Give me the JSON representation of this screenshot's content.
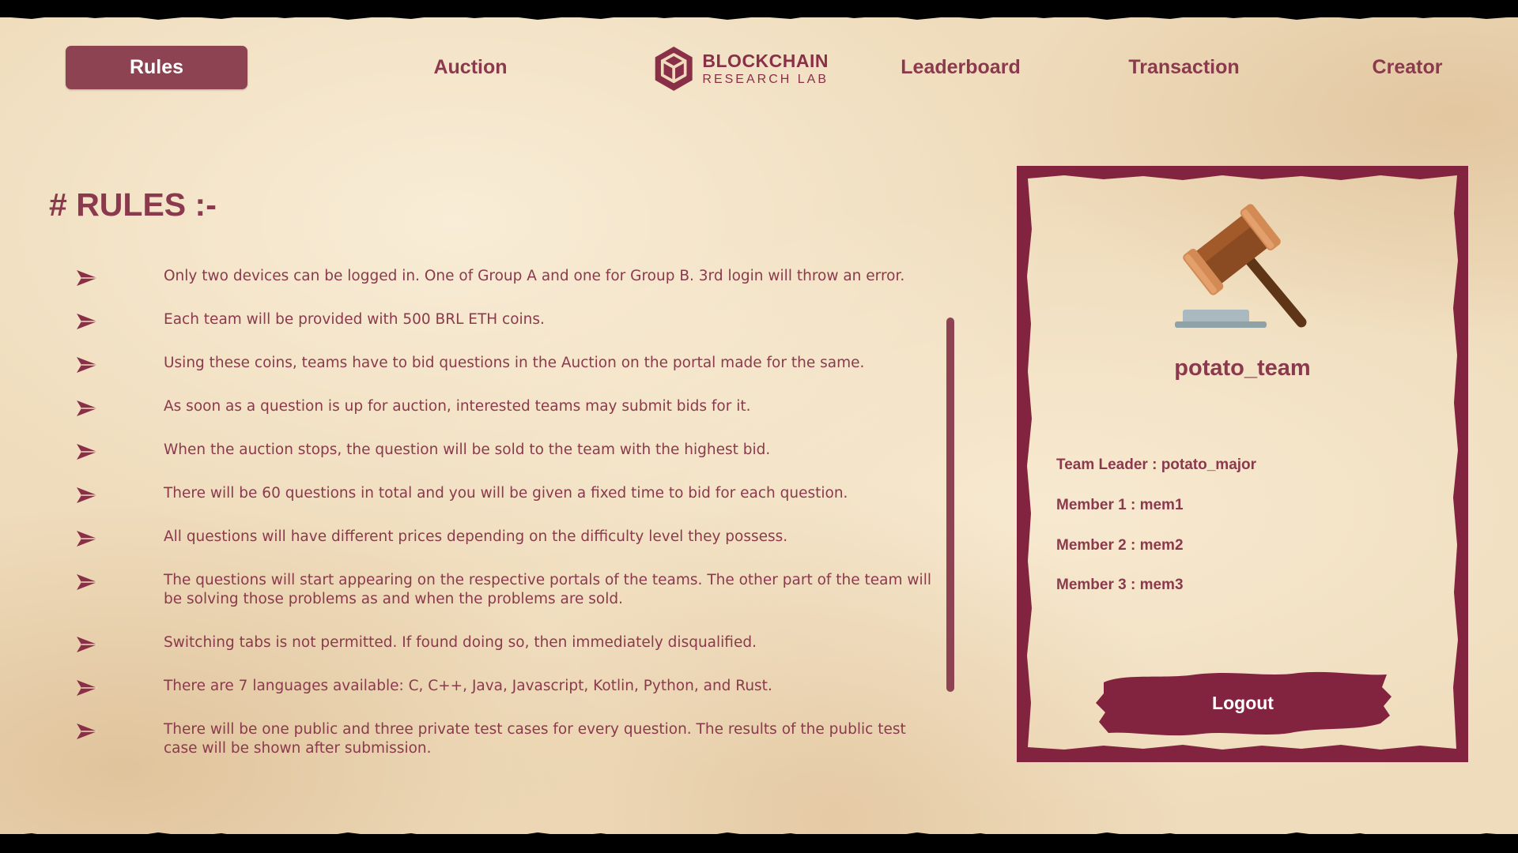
{
  "nav": {
    "rules": "Rules",
    "auction": "Auction",
    "leaderboard": "Leaderboard",
    "transaction": "Transaction",
    "creator": "Creator",
    "active_tab": "Rules"
  },
  "logo": {
    "title": "BLOCKCHAIN",
    "subtitle": "RESEARCH LAB",
    "icon": "cube-hexagon-icon"
  },
  "rules": {
    "title": "# RULES :-",
    "bullet_icon": "paper-plane-arrow-icon",
    "items": [
      "Only two devices can be logged in. One of Group A and one for Group B. 3rd login will throw an error.",
      "Each team will be provided with 500 BRL ETH coins.",
      "Using these coins, teams have to bid questions in the Auction on the portal made for the same.",
      "As soon as a question is up for auction, interested teams may submit bids for it.",
      "When the auction stops, the question will be sold to the team with the highest bid.",
      "There will be 60 questions in total and you will be given a fixed time to bid for each question.",
      "All questions will have different prices depending on the difficulty level they possess.",
      "The questions will start appearing on the respective portals of the teams. The other part of the team will be solving those problems as and when the problems are sold.",
      "Switching tabs is not permitted. If found doing so, then immediately disqualified.",
      "There are 7 languages available: C, C++, Java, Javascript, Kotlin, Python, and Rust.",
      "There will be one public and three private test cases for every question. The results of the public test case will be shown after submission."
    ]
  },
  "team": {
    "icon": "gavel-icon",
    "name": "potato_team",
    "leader": "Team Leader : potato_major",
    "members": [
      "Member 1 : mem1",
      "Member 2 : mem2",
      "Member 3 : mem3"
    ],
    "logout_label": "Logout"
  },
  "colors": {
    "accent": "#8a2f48",
    "active_tab_bg": "#8e4352",
    "text": "#8a3a4c",
    "paper": "#efdcbc",
    "logout_bg": "#822440"
  }
}
